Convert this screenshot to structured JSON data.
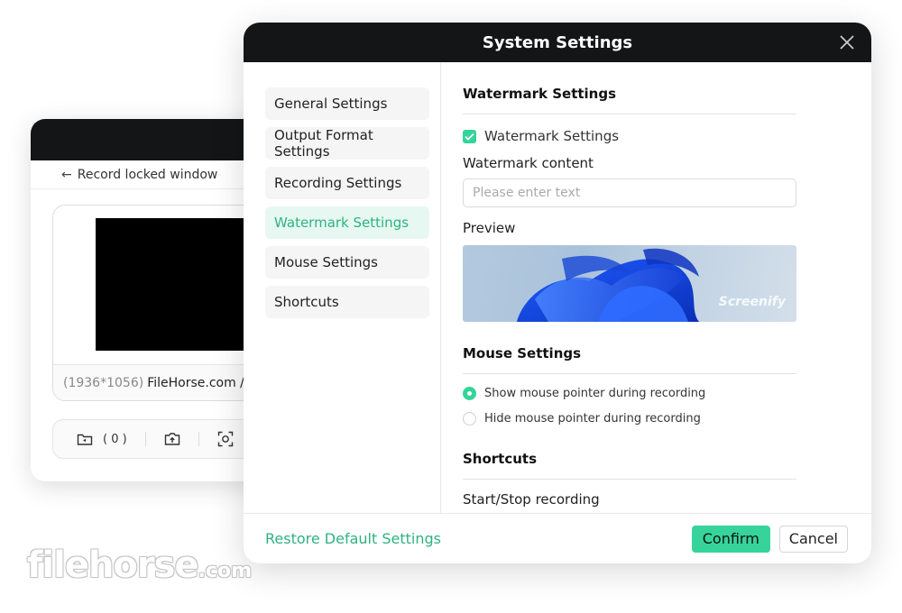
{
  "background_window": {
    "back_label": "Record locked window",
    "resolution": "(1936*1056)",
    "window_name": "FileHorse.com / F",
    "toolbar": {
      "folder_count": "( 0 )"
    }
  },
  "dialog": {
    "title": "System Settings",
    "nav": [
      {
        "label": "General Settings"
      },
      {
        "label": "Output Format Settings"
      },
      {
        "label": "Recording Settings"
      },
      {
        "label": "Watermark Settings",
        "active": true
      },
      {
        "label": "Mouse Settings"
      },
      {
        "label": "Shortcuts"
      }
    ],
    "watermark": {
      "section_title": "Watermark Settings",
      "checkbox_label": "Watermark Settings",
      "checkbox_checked": true,
      "content_label": "Watermark content",
      "content_placeholder": "Please enter text",
      "content_value": "",
      "preview_label": "Preview",
      "preview_text": "Screenify"
    },
    "mouse": {
      "section_title": "Mouse Settings",
      "options": [
        {
          "label": "Show mouse pointer during recording",
          "selected": true
        },
        {
          "label": "Hide mouse pointer during recording",
          "selected": false
        }
      ]
    },
    "shortcuts": {
      "section_title": "Shortcuts",
      "first_item": "Start/Stop recording"
    },
    "footer": {
      "restore_label": "Restore Default Settings",
      "confirm_label": "Confirm",
      "cancel_label": "Cancel"
    }
  },
  "site_watermark": {
    "main": "filehorse",
    "suffix": ".com"
  },
  "colors": {
    "accent": "#34d49a",
    "accent_text": "#2fb37f",
    "header": "#131516"
  }
}
